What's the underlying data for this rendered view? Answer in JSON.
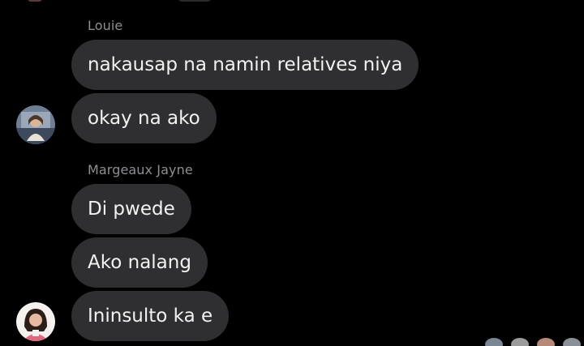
{
  "thread": {
    "groups": [
      {
        "sender": "Louie",
        "messages": [
          "nakausap na namin relatives niya",
          "okay na ako"
        ]
      },
      {
        "sender": "Margeaux Jayne",
        "messages": [
          "Di pwede",
          "Ako nalang",
          "Ininsulto ka e"
        ]
      }
    ]
  },
  "colors": {
    "background": "#000000",
    "bubble": "#2f2f31",
    "bubble_text": "#f2f2f2",
    "sender_name": "#8e8e93"
  },
  "icons": {
    "louie_avatar": "profile-photo",
    "margeaux_avatar": "profile-photo",
    "seen_receipts": "seen-avatars"
  }
}
